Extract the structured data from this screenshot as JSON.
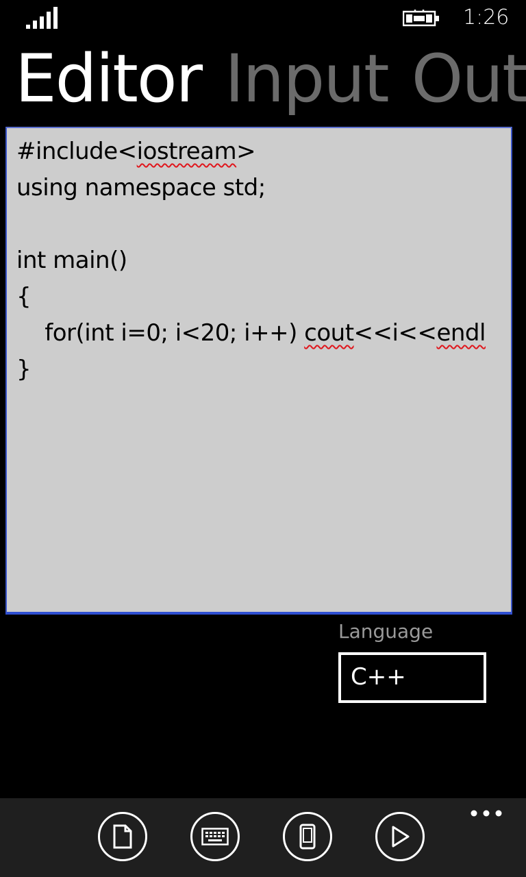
{
  "status": {
    "time": "1:26",
    "signal_icon": "signal-strength-icon",
    "battery_icon": "battery-charging-icon"
  },
  "pivot": {
    "items": [
      {
        "label": "Editor",
        "active": true
      },
      {
        "label": "Input",
        "active": false
      },
      {
        "label": "Output",
        "active": false
      }
    ]
  },
  "editor": {
    "lines": [
      "#include<iostream>",
      "using namespace std;",
      "",
      "int main()",
      "{",
      "    for(int i=0; i<20; i++) cout<<i<<endl",
      "}"
    ],
    "spellcheck_flagged": [
      "iostream",
      "cout",
      "endl"
    ]
  },
  "language": {
    "label": "Language",
    "value": "C++"
  },
  "appbar": {
    "buttons": [
      {
        "name": "new-file-button",
        "icon": "document-icon"
      },
      {
        "name": "keyboard-button",
        "icon": "keyboard-icon"
      },
      {
        "name": "device-button",
        "icon": "phone-icon"
      },
      {
        "name": "run-button",
        "icon": "play-icon"
      }
    ],
    "more_icon": "more-dots-icon"
  },
  "colors": {
    "background": "#000000",
    "editor_bg": "#cdcdcd",
    "accent": "#2f4fd1",
    "inactive_text": "#6b6b6b",
    "spell_error": "#e0161c",
    "appbar_bg": "#1f1f1f"
  }
}
